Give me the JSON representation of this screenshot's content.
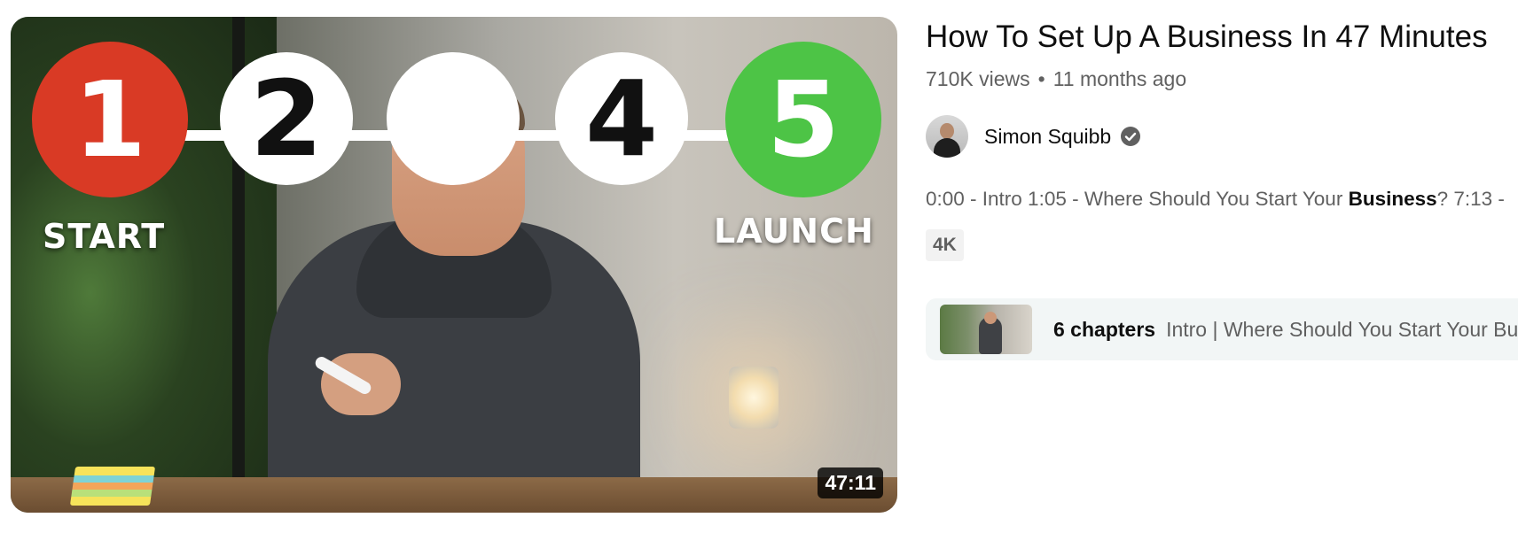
{
  "video": {
    "title": "How To Set Up A Business In 47 Minutes",
    "views": "710K views",
    "age": "11 months ago",
    "duration": "47:11",
    "channel": {
      "name": "Simon Squibb",
      "verified": true,
      "avatar_icon": "avatar-icon"
    },
    "description": {
      "before": "0:00 - Intro 1:05 - Where Should You Start Your ",
      "bold": "Business",
      "after": "? 7:13 - "
    },
    "badge": "4K",
    "chapters": {
      "count_label": "6 chapters",
      "names": "Intro | Where Should You Start Your Bu"
    }
  },
  "thumbnail": {
    "steps": [
      "1",
      "2",
      "4",
      "5"
    ],
    "start_label": "START",
    "launch_label": "LAUNCH",
    "colors": {
      "step1": "#d93a25",
      "step5": "#4dc446",
      "plain": "#ffffff"
    }
  },
  "colors": {
    "secondary_text": "#606060",
    "primary_text": "#0f0f0f"
  }
}
